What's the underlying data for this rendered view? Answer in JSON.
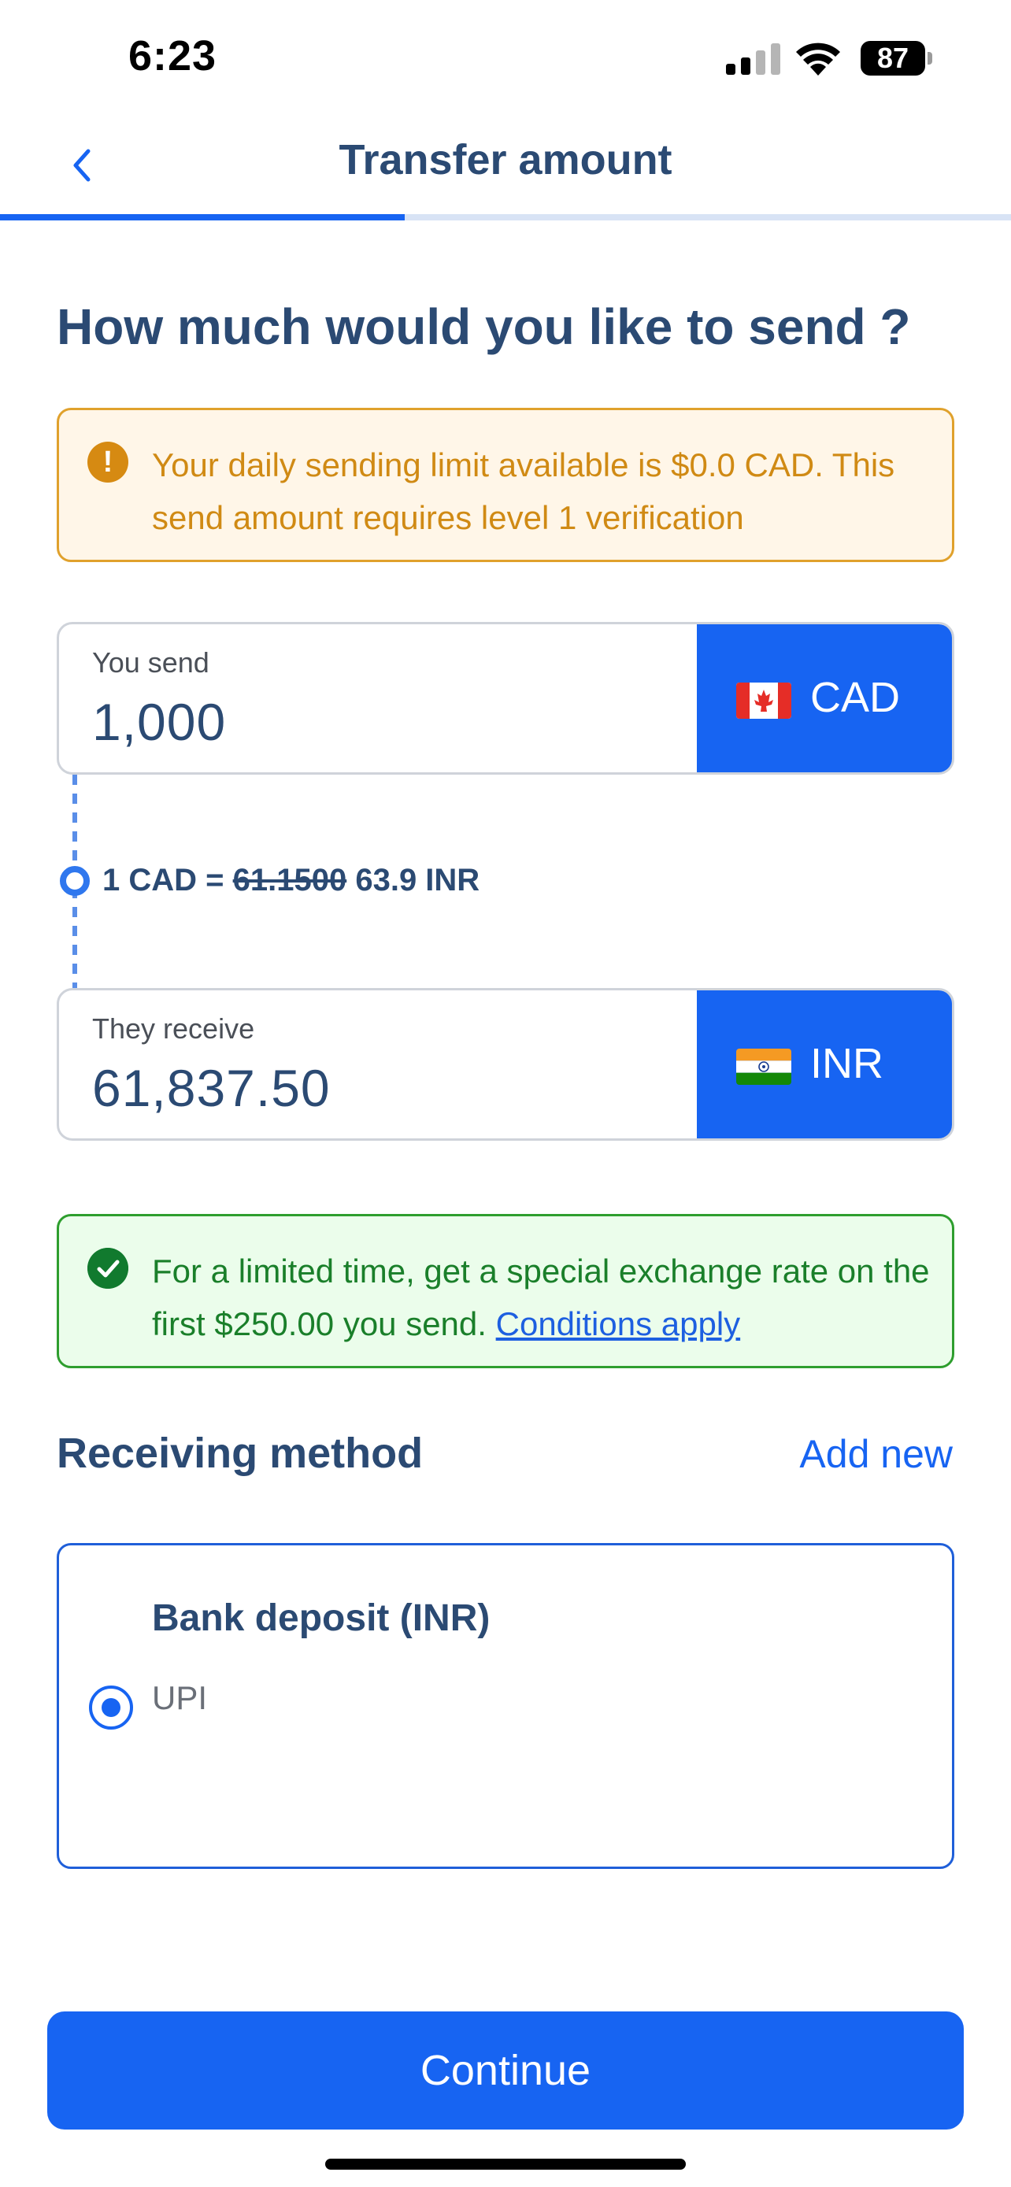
{
  "status_bar": {
    "time": "6:23",
    "battery": "87"
  },
  "header": {
    "title": "Transfer amount",
    "progress_fraction": 0.4
  },
  "heading": "How much would you like to send ?",
  "warning": {
    "text": "Your daily sending limit available is $0.0 CAD. This send amount requires level 1 verification",
    "icon": "exclamation-icon",
    "color": "#e0a12c"
  },
  "send": {
    "label": "You send",
    "value": "1,000",
    "currency": "CAD"
  },
  "rate": {
    "prefix": "1 CAD =",
    "old": "61.1500",
    "new": "63.9 INR"
  },
  "receive": {
    "label": "They receive",
    "value": "61,837.50",
    "currency": "INR"
  },
  "promo": {
    "text": "For a limited time, get a special exchange rate on the first  $250.00 you send.",
    "link": "Conditions apply",
    "icon": "check-circle-icon",
    "color": "#2e9e2e"
  },
  "receiving_method": {
    "title": "Receiving method",
    "add_new": "Add new",
    "card_title": "Bank deposit (INR)",
    "option": "UPI"
  },
  "continue_label": "Continue",
  "colors": {
    "accent": "#1764f2",
    "heading": "#2b4a73"
  }
}
